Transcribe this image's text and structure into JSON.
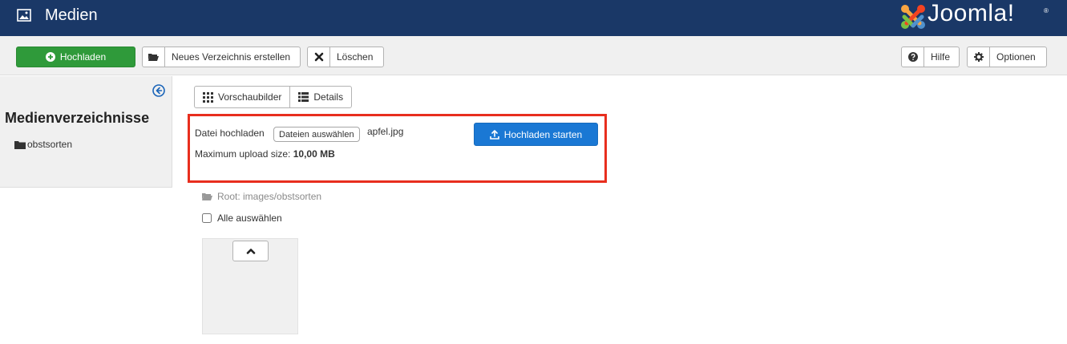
{
  "header": {
    "title": "Medien",
    "title_icon": "image-icon",
    "brand": "Joomla!",
    "brand_mark": "®",
    "colors": {
      "bar": "#1a3867"
    }
  },
  "toolbar": {
    "upload_label": "Hochladen",
    "upload_icon": "plus-circle-icon",
    "new_folder_label": "Neues Verzeichnis erstellen",
    "new_folder_icon": "folder-open-icon",
    "delete_label": "Löschen",
    "delete_icon": "close-icon",
    "help_label": "Hilfe",
    "help_icon": "question-circle-icon",
    "options_label": "Optionen",
    "options_icon": "gear-icon",
    "colors": {
      "upload": "#2f9a3a"
    }
  },
  "sidebar": {
    "heading": "Medienverzeichnisse",
    "collapse_icon": "arrow-left-circle-icon",
    "items": [
      {
        "label": "obstsorten",
        "icon": "folder-icon"
      }
    ]
  },
  "view": {
    "thumbnails_label": "Vorschaubilder",
    "thumbnails_icon": "grid-icon",
    "details_label": "Details",
    "details_icon": "list-icon"
  },
  "upload": {
    "label": "Datei hochladen",
    "choose_button": "Dateien auswählen",
    "file_name": "apfel.jpg",
    "max_size_label": "Maximum upload size:",
    "max_size_value": "10,00 MB",
    "start_button": "Hochladen starten",
    "start_icon": "upload-icon",
    "colors": {
      "highlight": "#e82e1e",
      "start": "#1a78d4"
    }
  },
  "content": {
    "root_path": "Root: images/obstsorten",
    "root_icon": "folder-open-icon",
    "select_all_label": "Alle auswählen",
    "select_all_checked": false,
    "up_icon": "chevron-up-icon"
  }
}
